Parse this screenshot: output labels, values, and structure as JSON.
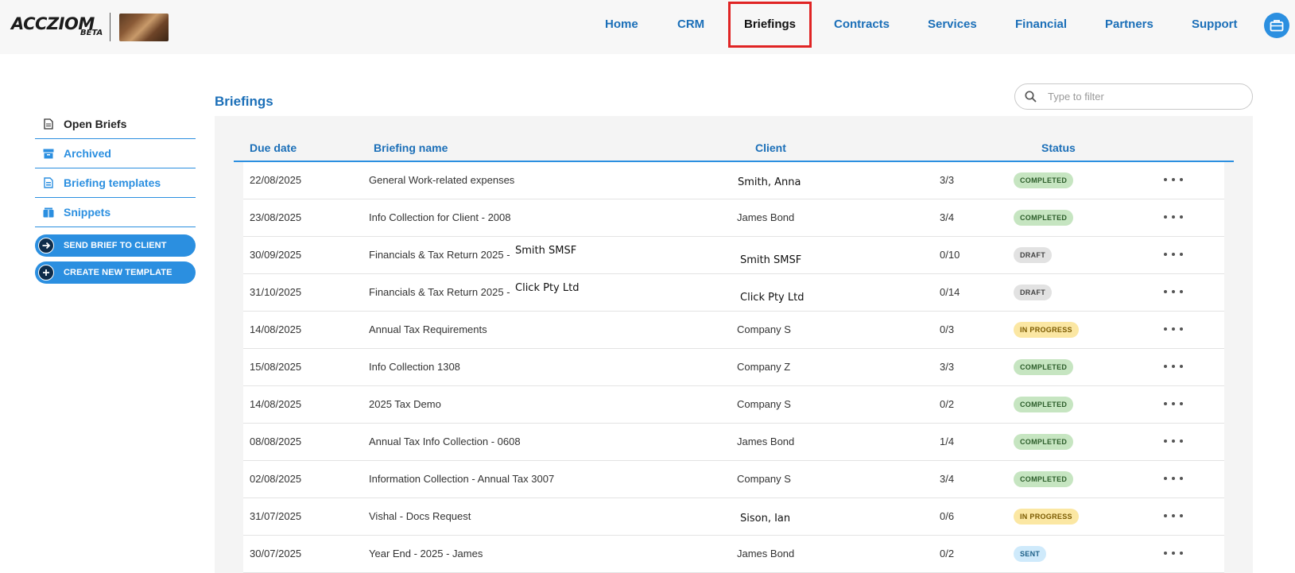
{
  "header": {
    "logo_text": "ACCZIOM",
    "logo_beta": "BETA",
    "nav": [
      {
        "label": "Home"
      },
      {
        "label": "CRM"
      },
      {
        "label": "Briefings"
      },
      {
        "label": "Contracts"
      },
      {
        "label": "Services"
      },
      {
        "label": "Financial"
      },
      {
        "label": "Partners"
      },
      {
        "label": "Support"
      }
    ],
    "active_nav": "Briefings",
    "user_icon": "briefcase-icon"
  },
  "sidebar": {
    "items": [
      {
        "label": "Open Briefs",
        "icon": "document-icon"
      },
      {
        "label": "Archived",
        "icon": "archive-icon"
      },
      {
        "label": "Briefing templates",
        "icon": "template-icon"
      },
      {
        "label": "Snippets",
        "icon": "snippet-icon"
      }
    ],
    "buttons": [
      {
        "label": "SEND BRIEF TO CLIENT",
        "icon": "arrow-right-icon"
      },
      {
        "label": "CREATE NEW TEMPLATE",
        "icon": "plus-icon"
      }
    ]
  },
  "main": {
    "title": "Briefings",
    "filter_placeholder": "Type to filter",
    "columns": {
      "due_date": "Due date",
      "name": "Briefing name",
      "client": "Client",
      "status": "Status"
    },
    "rows": [
      {
        "due": "22/08/2025",
        "name": "General Work-related expenses",
        "name_extra": "",
        "client": "Smith, Anna",
        "progress": "3/3",
        "status": "COMPLETED"
      },
      {
        "due": "23/08/2025",
        "name": "Info Collection for Client - 2008",
        "name_extra": "",
        "client": "James Bond",
        "progress": "3/4",
        "status": "COMPLETED"
      },
      {
        "due": "30/09/2025",
        "name": "Financials & Tax Return 2025 -",
        "name_extra": "Smith SMSF",
        "client": "Smith SMSF",
        "progress": "0/10",
        "status": "DRAFT"
      },
      {
        "due": "31/10/2025",
        "name": "Financials & Tax Return 2025 -",
        "name_extra": "Click Pty Ltd",
        "client": "Click Pty Ltd",
        "progress": "0/14",
        "status": "DRAFT"
      },
      {
        "due": "14/08/2025",
        "name": "Annual Tax Requirements",
        "name_extra": "",
        "client": "Company S",
        "progress": "0/3",
        "status": "IN PROGRESS"
      },
      {
        "due": "15/08/2025",
        "name": "Info Collection 1308",
        "name_extra": "",
        "client": "Company Z",
        "progress": "3/3",
        "status": "COMPLETED"
      },
      {
        "due": "14/08/2025",
        "name": "2025 Tax Demo",
        "name_extra": "",
        "client": "Company S",
        "progress": "0/2",
        "status": "COMPLETED"
      },
      {
        "due": "08/08/2025",
        "name": "Annual Tax Info Collection - 0608",
        "name_extra": "",
        "client": "James Bond",
        "progress": "1/4",
        "status": "COMPLETED"
      },
      {
        "due": "02/08/2025",
        "name": "Information Collection - Annual Tax 3007",
        "name_extra": "",
        "client": "Company S",
        "progress": "3/4",
        "status": "COMPLETED"
      },
      {
        "due": "31/07/2025",
        "name": "Vishal - Docs Request",
        "name_extra": "",
        "client": "Sison, Ian",
        "progress": "0/6",
        "status": "IN PROGRESS"
      },
      {
        "due": "30/07/2025",
        "name": "Year End - 2025 - James",
        "name_extra": "",
        "client": "James Bond",
        "progress": "0/2",
        "status": "SENT"
      }
    ]
  },
  "colors": {
    "accent": "#2b8fe0",
    "nav_text": "#1b6fb8",
    "highlight": "#e02424",
    "completed": "#c6e5c1",
    "draft": "#e2e2e2",
    "in_progress": "#fbe7a3",
    "sent": "#cfeafb"
  }
}
